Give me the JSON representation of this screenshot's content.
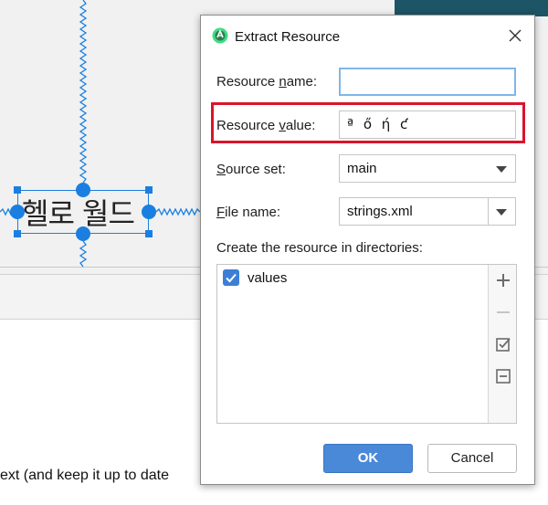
{
  "background": {
    "preview_text": "헬로 월드",
    "panel_text": "ext (and keep it up to date"
  },
  "dialog": {
    "title": "Extract Resource",
    "resource_name": {
      "label_pre": "Resource ",
      "label_mn": "n",
      "label_post": "ame:",
      "value": ""
    },
    "resource_value": {
      "label_pre": "Resource ",
      "label_mn": "v",
      "label_post": "alue:",
      "value": "ª ő ή ƈ"
    },
    "source_set": {
      "label_pre": "",
      "label_mn": "S",
      "label_post": "ource set:",
      "value": "main"
    },
    "file_name": {
      "label_pre": "",
      "label_mn": "F",
      "label_post": "ile name:",
      "value": "strings.xml"
    },
    "directories": {
      "label": "Create the resource in directories:",
      "items": [
        {
          "label": "values",
          "checked": true
        }
      ]
    },
    "ok_label": "OK",
    "cancel_label": "Cancel"
  },
  "colors": {
    "accent": "#4a89d8",
    "highlight": "#d9142a",
    "selection": "#1a7fe0",
    "teal": "#1d5566"
  }
}
